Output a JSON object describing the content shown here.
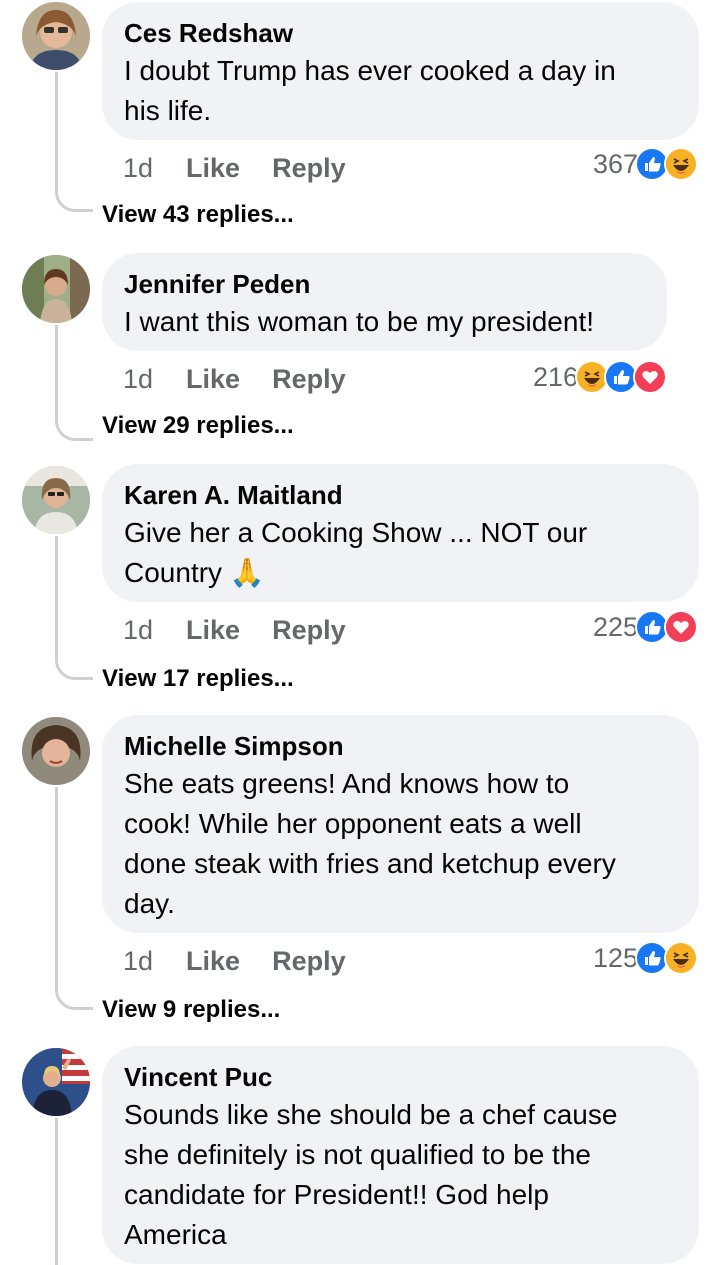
{
  "comments": [
    {
      "author": "Ces Redshaw",
      "text": "I doubt Trump has ever cooked a day in\nhis life.",
      "time": "1d",
      "like_label": "Like",
      "reply_label": "Reply",
      "reaction_count": "367",
      "reactions": [
        "like-icon",
        "haha-icon"
      ],
      "view_replies": "View 43 replies..."
    },
    {
      "author": "Jennifer Peden",
      "text": "I want this woman to be my president!",
      "time": "1d",
      "like_label": "Like",
      "reply_label": "Reply",
      "reaction_count": "216",
      "reactions": [
        "haha-icon",
        "like-icon",
        "love-icon"
      ],
      "view_replies": "View 29 replies..."
    },
    {
      "author": "Karen A. Maitland",
      "text": "Give her a Cooking Show ... NOT our\nCountry 🙏",
      "time": "1d",
      "like_label": "Like",
      "reply_label": "Reply",
      "reaction_count": "225",
      "reactions": [
        "like-icon",
        "love-icon"
      ],
      "view_replies": "View 17 replies..."
    },
    {
      "author": "Michelle Simpson",
      "text": "She eats greens!  And knows how to\ncook!  While her opponent eats a well\ndone steak with fries and ketchup every\nday.",
      "time": "1d",
      "like_label": "Like",
      "reply_label": "Reply",
      "reaction_count": "125",
      "reactions": [
        "like-icon",
        "haha-icon"
      ],
      "view_replies": "View 9 replies..."
    },
    {
      "author": "Vincent Puc",
      "text": "Sounds like she should be a chef cause\nshe definitely is not qualified to be the\ncandidate for President!! God help\nAmerica"
    }
  ],
  "colors": {
    "bubble": "#f0f2f5",
    "secondary_text": "#65676b",
    "like_blue": "#1877f2",
    "love_red": "#f33e58",
    "haha_yellow": "#f7b125"
  }
}
